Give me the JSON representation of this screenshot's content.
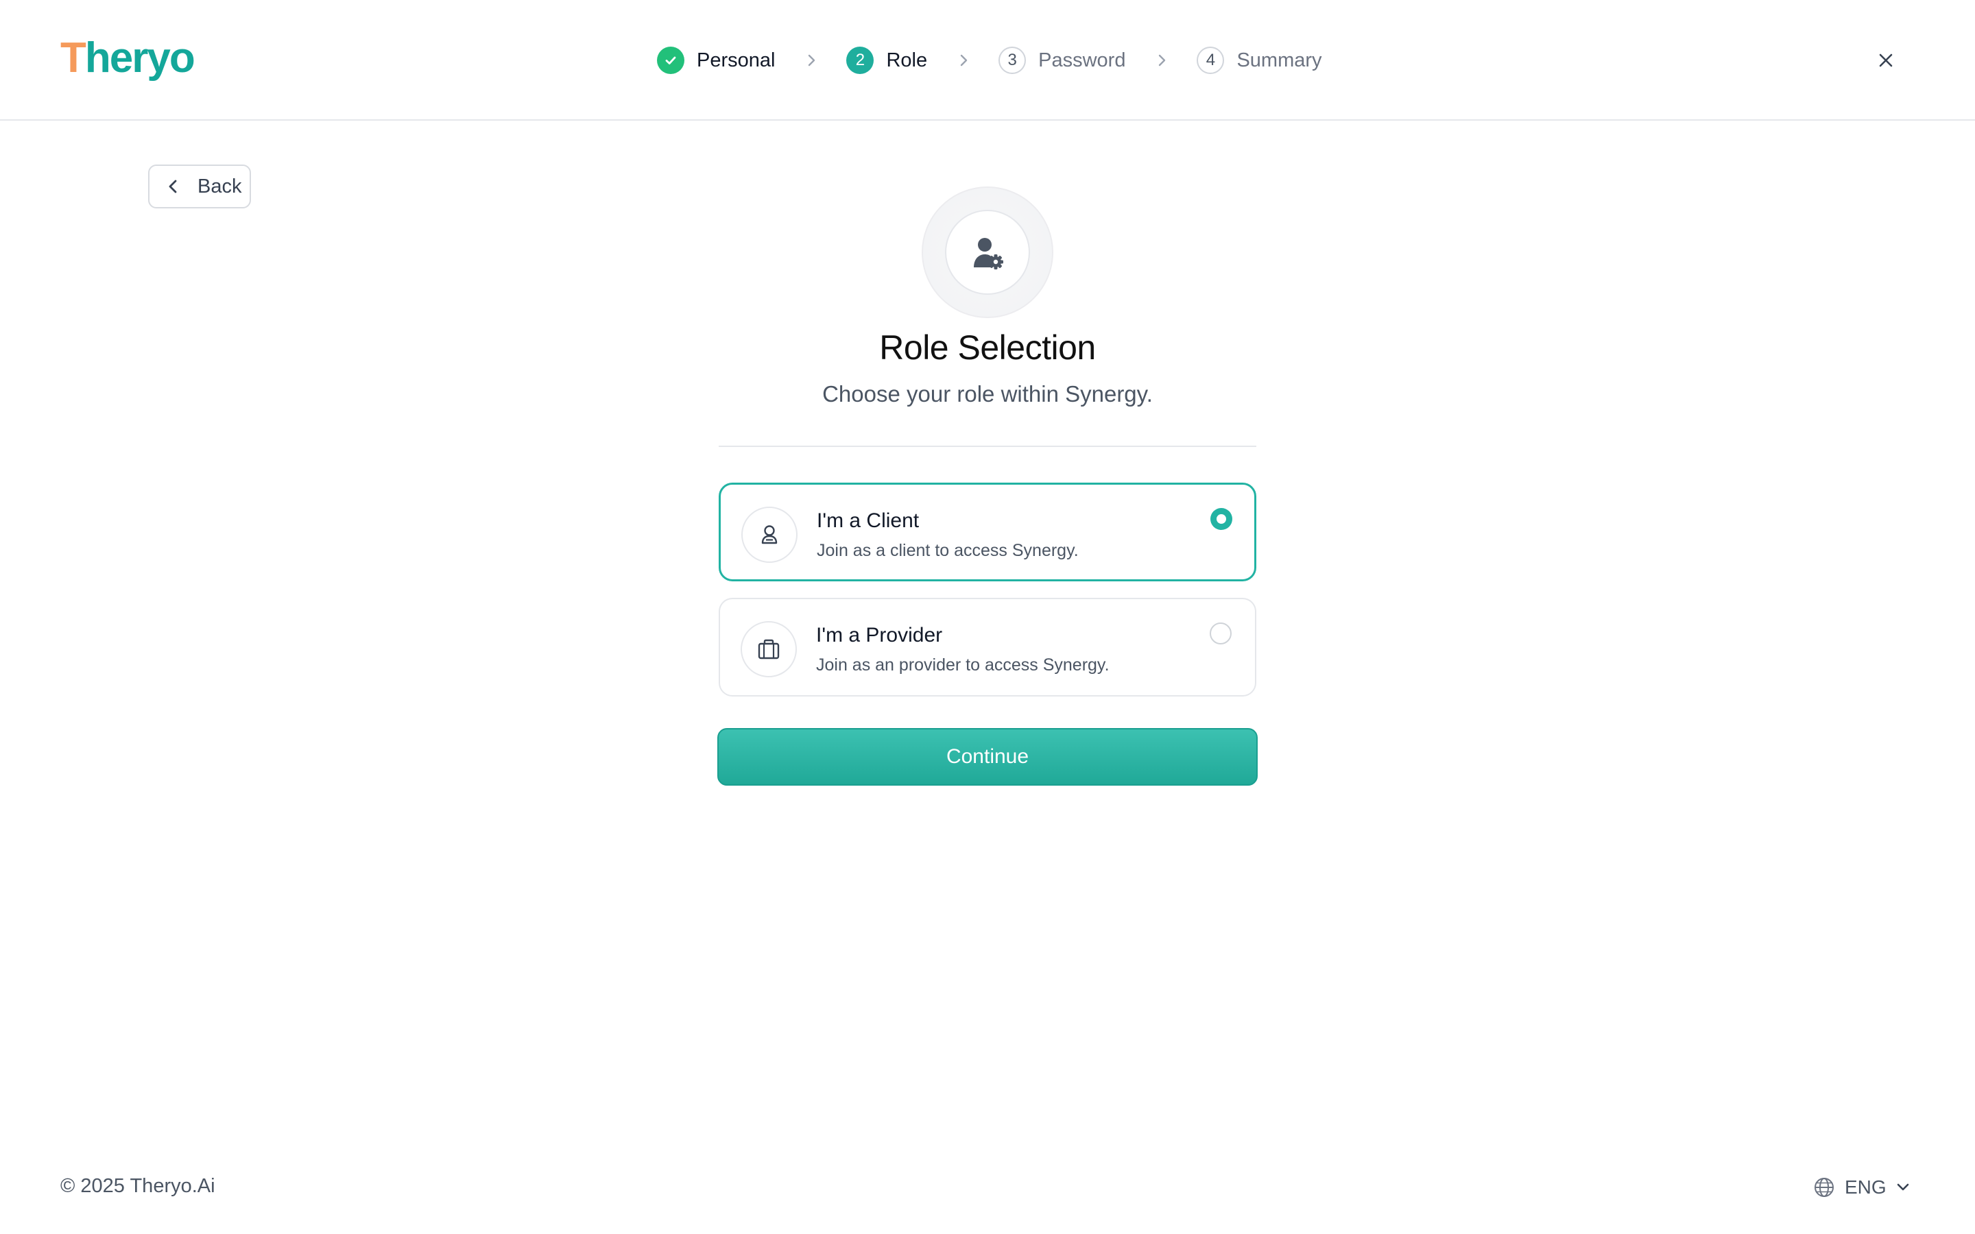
{
  "header": {
    "logo": {
      "first_letter": "T",
      "rest": "heryo"
    },
    "steps": [
      {
        "number": "✓",
        "label": "Personal",
        "state": "done"
      },
      {
        "number": "2",
        "label": "Role",
        "state": "active"
      },
      {
        "number": "3",
        "label": "Password",
        "state": "pending"
      },
      {
        "number": "4",
        "label": "Summary",
        "state": "pending"
      }
    ],
    "close_icon": "close-icon"
  },
  "back": {
    "label": "Back",
    "icon": "chevron-left-icon"
  },
  "hero": {
    "icon": "user-gear-icon"
  },
  "title": "Role Selection",
  "subtitle": "Choose your role within Synergy.",
  "roles": [
    {
      "title": "I'm a Client",
      "description": "Join as a client to access Synergy.",
      "icon": "user-icon",
      "selected": true
    },
    {
      "title": "I'm a Provider",
      "description": "Join as an provider to access Synergy.",
      "icon": "briefcase-icon",
      "selected": false
    }
  ],
  "continue_label": "Continue",
  "footer": {
    "copyright": "© 2025 Theryo.Ai",
    "language": "ENG"
  },
  "colors": {
    "brand": "#14a79a",
    "brand_accent": "#f59a5b",
    "step_done": "#22c07a",
    "step_active": "#1fae9d",
    "selected_border": "#22b3a3",
    "button": "#26ad9c"
  }
}
